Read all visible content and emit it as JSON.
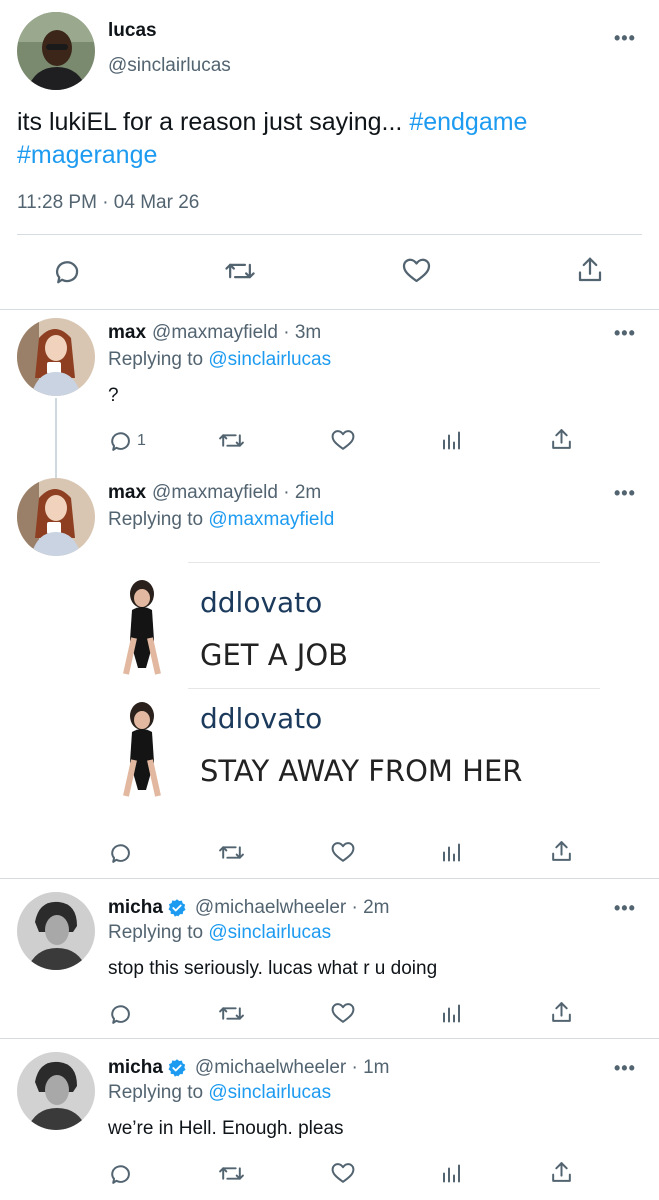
{
  "main_tweet": {
    "name": "lucas",
    "handle": "@sinclairlucas",
    "text_plain": "its lukiEL for a reason just saying... ",
    "hashtag1": "#endgame",
    "hashtag2": "#magerange",
    "time": "11:28 PM · 04 Mar 26"
  },
  "replies": [
    {
      "name": "max",
      "handle": "@maxmayfield · 3m",
      "replying_prefix": "Replying to ",
      "replying_to": "@sinclairlucas",
      "text": "?",
      "reply_count": "1"
    },
    {
      "name": "max",
      "handle": "@maxmayfield · 2m",
      "replying_prefix": "Replying to ",
      "replying_to": "@maxmayfield",
      "embed": {
        "comments": [
          {
            "user": "ddlovato",
            "text": "GET A JOB"
          },
          {
            "user": "ddlovato",
            "text": "STAY AWAY FROM HER"
          }
        ]
      }
    },
    {
      "name": "micha",
      "handle": "@michaelwheeler · 2m",
      "replying_prefix": "Replying to ",
      "replying_to": "@sinclairlucas",
      "text": "stop this seriously. lucas what r u doing"
    },
    {
      "name": "micha",
      "handle": "@michaelwheeler · 1m",
      "replying_prefix": "Replying to ",
      "replying_to": "@sinclairlucas",
      "text": "we’re in Hell. Enough. pleas"
    }
  ],
  "more_label": "•••",
  "colors": {
    "accent": "#1d9bf0",
    "secondary": "#536471",
    "divider": "#d6dbe0"
  }
}
